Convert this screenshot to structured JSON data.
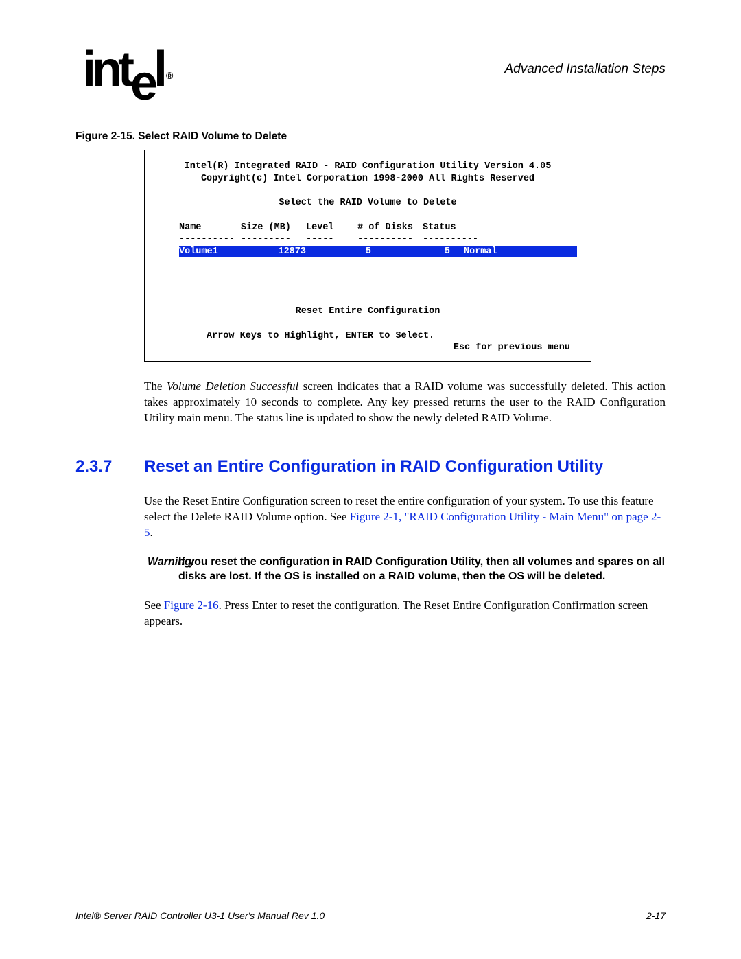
{
  "header": {
    "logo_text": "int",
    "logo_sub": "e",
    "logo_end": "l",
    "reg_mark": "®",
    "right_title": "Advanced Installation Steps"
  },
  "figure_caption": "Figure 2-15. Select RAID Volume to Delete",
  "terminal": {
    "line1": "Intel(R) Integrated RAID - RAID Configuration Utility Version 4.05",
    "line2": "Copyright(c) Intel Corporation 1998-2000 All Rights Reserved",
    "prompt": "Select the RAID Volume to Delete",
    "headers": {
      "name": "Name",
      "size": "Size (MB)",
      "level": "Level",
      "disks": "# of Disks",
      "status": "Status"
    },
    "separators": {
      "c1": "----------",
      "c2": "---------",
      "c3": "-----",
      "c4": "----------",
      "c5": "----------"
    },
    "row": {
      "name": "Volume1",
      "size": "12873",
      "level": "5",
      "disks": "5",
      "status": "Normal"
    },
    "reset_line": "Reset Entire Configuration",
    "nav_line": "Arrow Keys to Highlight, ENTER to Select.",
    "esc_line": "Esc for previous menu"
  },
  "body1": {
    "pre": "The ",
    "italic": "Volume Deletion Successful",
    "post": " screen indicates that a RAID volume was successfully deleted. This action takes approximately 10 seconds to complete. Any key pressed returns the user to the RAID Configuration Utility main menu. The status line is updated to show the newly deleted RAID Volume."
  },
  "section": {
    "number": "2.3.7",
    "title": "Reset an Entire Configuration in RAID Configuration Utility"
  },
  "body2": {
    "pre": "Use the ",
    "italic": "Reset Entire Configuration",
    "mid": " screen to reset the entire configuration of your system. To use this feature select the Delete RAID Volume option. See ",
    "link": "Figure 2-1, \"RAID Configuration Utility - Main Menu\" on page 2-5",
    "post": "."
  },
  "warning": {
    "label": "Warning:",
    "text": "If you reset the configuration in RAID Configuration Utility, then all volumes and spares on all disks are lost. If the OS is installed on a RAID volume, then the OS will be deleted."
  },
  "body3": {
    "pre": "See ",
    "link": "Figure 2-16",
    "mid": ". Press Enter to reset the configuration. The ",
    "italic": "Reset Entire Configuration Confirmation",
    "post": " screen appears."
  },
  "footer": {
    "left": "Intel® Server RAID Controller U3-1 User's Manual Rev 1.0",
    "right": "2-17"
  }
}
